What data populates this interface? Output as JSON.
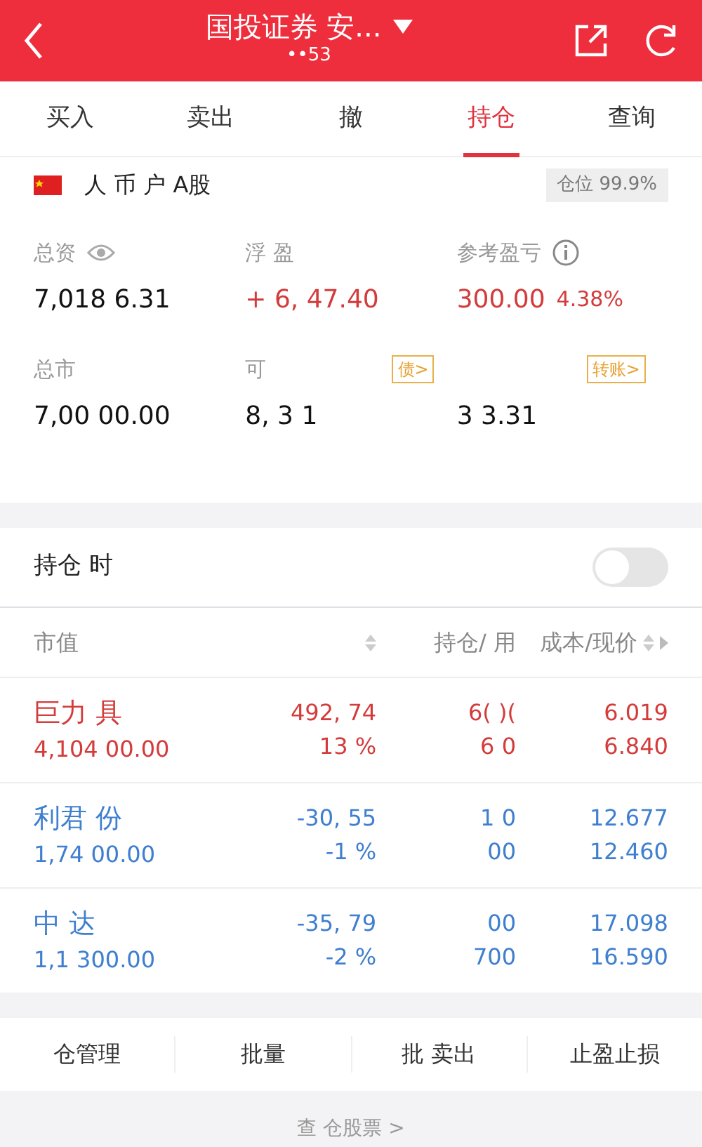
{
  "header": {
    "title": "国投证券 安...",
    "subtitle": "••53"
  },
  "tabs": [
    {
      "label": "买入",
      "selected": false
    },
    {
      "label": "卖出",
      "selected": false
    },
    {
      "label": "撤",
      "selected": false
    },
    {
      "label": "持仓",
      "selected": true
    },
    {
      "label": "查询",
      "selected": false
    }
  ],
  "account": {
    "label": "人 币 户 A股",
    "position_badge": "仓位 99.9%"
  },
  "metrics": [
    {
      "label": "总资",
      "value": "7,018 6.31",
      "color": "#111111"
    },
    {
      "label": "浮 盈",
      "value": "+ 6, 47.40",
      "color": "#d43c3c"
    },
    {
      "label": "参考盈亏",
      "value": "300.00",
      "extra": "4.38%",
      "color": "#d43c3c"
    },
    {
      "label": "总市",
      "value": "7,00 00.00",
      "color": "#111111"
    },
    {
      "label": "可",
      "link": "债>",
      "value": "8, 3 1",
      "color": "#111111"
    },
    {
      "link": "转账>",
      "value": "3 3.31",
      "color": "#111111"
    }
  ],
  "toggle": {
    "label": "持仓 时",
    "on": false
  },
  "columns": [
    {
      "label": "市值",
      "sort": false
    },
    {
      "sort": true
    },
    {
      "label": "持仓/ 用",
      "sort": false
    },
    {
      "label": "成本/现价",
      "sort": true
    }
  ],
  "holdings": [
    {
      "color": "#d43c3c",
      "name": "巨力 具",
      "market_value": "4,104 00.00",
      "pl": "492, 74",
      "pl_pct": "13 %",
      "qty": "6( )(",
      "avail": "6 0",
      "cost": "6.019",
      "price": "6.840"
    },
    {
      "color": "#3f7fcf",
      "name": "利君 份",
      "market_value": "1,74 00.00",
      "pl": "-30, 55",
      "pl_pct": "-1 %",
      "qty": "1 0",
      "avail": "00",
      "cost": "12.677",
      "price": "12.460"
    },
    {
      "color": "#3f7fcf",
      "name": "中 达",
      "market_value": "1,1 300.00",
      "pl": "-35, 79",
      "pl_pct": "-2 %",
      "qty": "00",
      "avail": "700",
      "cost": "17.098",
      "price": "16.590"
    }
  ],
  "actions": [
    "仓管理",
    "批量",
    "批 卖出",
    "止盈止损"
  ],
  "footer_link": "查 仓股票 >"
}
